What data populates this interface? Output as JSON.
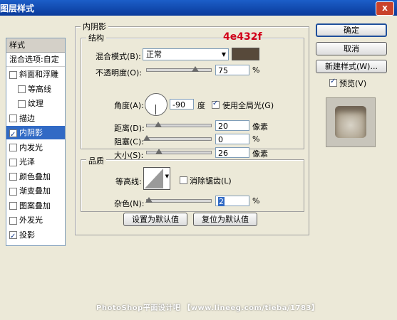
{
  "window": {
    "title": "图层样式",
    "close_label": "x"
  },
  "style_list": {
    "header": "样式",
    "blend_options": "混合选项:自定",
    "items": [
      {
        "label": "斜面和浮雕",
        "checked": false,
        "indent": false
      },
      {
        "label": "等高线",
        "checked": false,
        "indent": true
      },
      {
        "label": "纹理",
        "checked": false,
        "indent": true
      },
      {
        "label": "描边",
        "checked": false,
        "indent": false
      },
      {
        "label": "内阴影",
        "checked": true,
        "indent": false,
        "selected": true
      },
      {
        "label": "内发光",
        "checked": false,
        "indent": false
      },
      {
        "label": "光泽",
        "checked": false,
        "indent": false
      },
      {
        "label": "颜色叠加",
        "checked": false,
        "indent": false
      },
      {
        "label": "渐变叠加",
        "checked": false,
        "indent": false
      },
      {
        "label": "图案叠加",
        "checked": false,
        "indent": false
      },
      {
        "label": "外发光",
        "checked": false,
        "indent": false
      },
      {
        "label": "投影",
        "checked": true,
        "indent": false
      }
    ]
  },
  "inner_shadow": {
    "section_title": "内阴影",
    "structure_title": "结构",
    "color_annotation": "4e432f",
    "shadow_color": "#57493a",
    "blend_mode_label": "混合模式(B):",
    "blend_mode_value": "正常",
    "opacity_label": "不透明度(O):",
    "opacity_value": "75",
    "percent": "%",
    "angle_label": "角度(A):",
    "angle_value": "-90",
    "degree": "度",
    "global_light_label": "使用全局光(G)",
    "distance_label": "距离(D):",
    "distance_value": "20",
    "choke_label": "阻塞(C):",
    "choke_value": "0",
    "size_label": "大小(S):",
    "size_value": "26",
    "pixels": "像素",
    "quality_title": "品质",
    "contour_label": "等高线:",
    "antialias_label": "消除锯齿(L)",
    "noise_label": "杂色(N):",
    "noise_value": "2",
    "make_default": "设置为默认值",
    "reset_default": "复位为默认值"
  },
  "buttons": {
    "ok": "确定",
    "cancel": "取消",
    "new_style": "新建样式(W)...",
    "preview_label": "预览(V)"
  },
  "watermark": "PhotoShop平面设计吧 【www.lineeg.com/tieba/1783】"
}
